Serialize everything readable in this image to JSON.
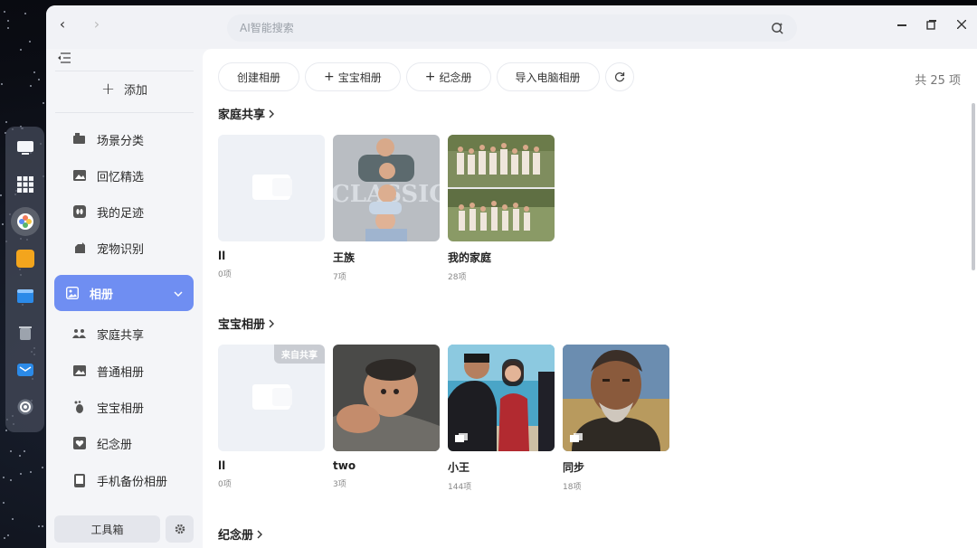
{
  "search": {
    "placeholder": "AI智能搜索"
  },
  "sidebar": {
    "add_label": "添加",
    "items": [
      {
        "label": "场景分类",
        "icon": "scene-icon"
      },
      {
        "label": "回忆精选",
        "icon": "image-icon"
      },
      {
        "label": "我的足迹",
        "icon": "footprint-icon"
      },
      {
        "label": "宠物识别",
        "icon": "pet-icon"
      },
      {
        "label": "相册",
        "icon": "album-icon",
        "active": true
      },
      {
        "label": "家庭共享",
        "icon": "family-icon"
      },
      {
        "label": "普通相册",
        "icon": "album-normal-icon"
      },
      {
        "label": "宝宝相册",
        "icon": "baby-icon"
      },
      {
        "label": "纪念册",
        "icon": "heart-icon"
      },
      {
        "label": "手机备份相册",
        "icon": "phone-icon"
      }
    ],
    "toolbox_label": "工具箱"
  },
  "toolbar": {
    "create": "创建相册",
    "baby": "宝宝相册",
    "memorial": "纪念册",
    "import": "导入电脑相册"
  },
  "count_label": "共 25 项",
  "sections": [
    {
      "title": "家庭共享",
      "cards": [
        {
          "name": "ll",
          "count": "0项"
        },
        {
          "name": "王族",
          "count": "7项"
        },
        {
          "name": "我的家庭",
          "count": "28项"
        }
      ]
    },
    {
      "title": "宝宝相册",
      "cards": [
        {
          "name": "ll",
          "count": "0项",
          "badge": "来自共享"
        },
        {
          "name": "two",
          "count": "3项"
        },
        {
          "name": "小王",
          "count": "144项"
        },
        {
          "name": "同步",
          "count": "18项"
        }
      ]
    },
    {
      "title": "纪念册",
      "cards": []
    }
  ],
  "colors": {
    "accent": "#6f8ef2",
    "window_bg": "#f4f5f8"
  }
}
